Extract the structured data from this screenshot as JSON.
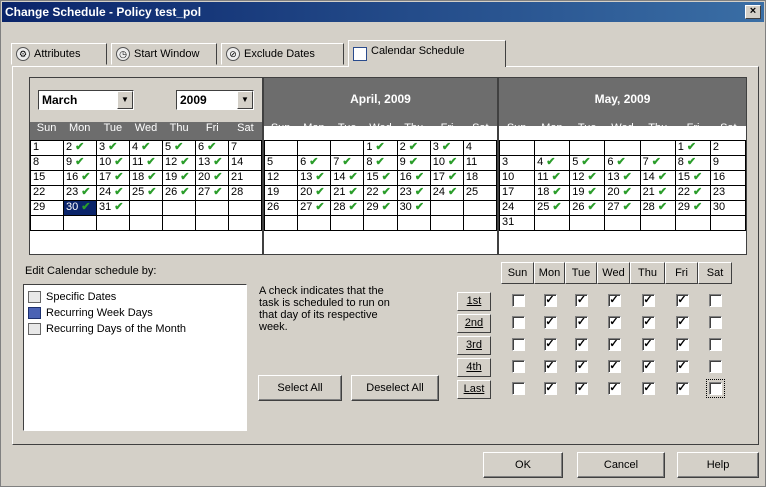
{
  "window": {
    "title": "Change Schedule - Policy test_pol",
    "close": "×"
  },
  "tabs": [
    {
      "label": "Attributes",
      "icon": "attributes-icon",
      "glyph": "⚙"
    },
    {
      "label": "Start Window",
      "icon": "start-window-icon",
      "glyph": "◷"
    },
    {
      "label": "Exclude Dates",
      "icon": "exclude-dates-icon",
      "glyph": "⊘"
    },
    {
      "label": "Calendar Schedule",
      "icon": "calendar-icon",
      "glyph": ""
    }
  ],
  "month_select": {
    "value": "March",
    "arrow": "▼"
  },
  "year_select": {
    "value": "2009",
    "arrow": "▼"
  },
  "calendars": [
    {
      "title": "",
      "dow": [
        "Sun",
        "Mon",
        "Tue",
        "Wed",
        "Thu",
        "Fri",
        "Sat"
      ],
      "weeks": [
        [
          {
            "d": "1",
            "c": false
          },
          {
            "d": "2",
            "c": true
          },
          {
            "d": "3",
            "c": true
          },
          {
            "d": "4",
            "c": true
          },
          {
            "d": "5",
            "c": true
          },
          {
            "d": "6",
            "c": true
          },
          {
            "d": "7",
            "c": false
          }
        ],
        [
          {
            "d": "8",
            "c": false
          },
          {
            "d": "9",
            "c": true
          },
          {
            "d": "10",
            "c": true
          },
          {
            "d": "11",
            "c": true
          },
          {
            "d": "12",
            "c": true
          },
          {
            "d": "13",
            "c": true
          },
          {
            "d": "14",
            "c": false
          }
        ],
        [
          {
            "d": "15",
            "c": false
          },
          {
            "d": "16",
            "c": true
          },
          {
            "d": "17",
            "c": true
          },
          {
            "d": "18",
            "c": true
          },
          {
            "d": "19",
            "c": true
          },
          {
            "d": "20",
            "c": true
          },
          {
            "d": "21",
            "c": false
          }
        ],
        [
          {
            "d": "22",
            "c": false
          },
          {
            "d": "23",
            "c": true
          },
          {
            "d": "24",
            "c": true
          },
          {
            "d": "25",
            "c": true
          },
          {
            "d": "26",
            "c": true
          },
          {
            "d": "27",
            "c": true
          },
          {
            "d": "28",
            "c": false
          }
        ],
        [
          {
            "d": "29",
            "c": false
          },
          {
            "d": "30",
            "c": true,
            "s": true
          },
          {
            "d": "31",
            "c": true
          },
          {
            "d": "",
            "c": false
          },
          {
            "d": "",
            "c": false
          },
          {
            "d": "",
            "c": false
          },
          {
            "d": "",
            "c": false
          }
        ],
        [
          {
            "d": "",
            "c": false
          },
          {
            "d": "",
            "c": false
          },
          {
            "d": "",
            "c": false
          },
          {
            "d": "",
            "c": false
          },
          {
            "d": "",
            "c": false
          },
          {
            "d": "",
            "c": false
          },
          {
            "d": "",
            "c": false
          }
        ]
      ]
    },
    {
      "title": "April, 2009",
      "dow": [
        "Sun",
        "Mon",
        "Tue",
        "Wed",
        "Thu",
        "Fri",
        "Sat"
      ],
      "weeks": [
        [
          {
            "d": "",
            "c": false
          },
          {
            "d": "",
            "c": false
          },
          {
            "d": "",
            "c": false
          },
          {
            "d": "1",
            "c": true
          },
          {
            "d": "2",
            "c": true
          },
          {
            "d": "3",
            "c": true
          },
          {
            "d": "4",
            "c": false
          }
        ],
        [
          {
            "d": "5",
            "c": false
          },
          {
            "d": "6",
            "c": true
          },
          {
            "d": "7",
            "c": true
          },
          {
            "d": "8",
            "c": true
          },
          {
            "d": "9",
            "c": true
          },
          {
            "d": "10",
            "c": true
          },
          {
            "d": "11",
            "c": false
          }
        ],
        [
          {
            "d": "12",
            "c": false
          },
          {
            "d": "13",
            "c": true
          },
          {
            "d": "14",
            "c": true
          },
          {
            "d": "15",
            "c": true
          },
          {
            "d": "16",
            "c": true
          },
          {
            "d": "17",
            "c": true
          },
          {
            "d": "18",
            "c": false
          }
        ],
        [
          {
            "d": "19",
            "c": false
          },
          {
            "d": "20",
            "c": true
          },
          {
            "d": "21",
            "c": true
          },
          {
            "d": "22",
            "c": true
          },
          {
            "d": "23",
            "c": true
          },
          {
            "d": "24",
            "c": true
          },
          {
            "d": "25",
            "c": false
          }
        ],
        [
          {
            "d": "26",
            "c": false
          },
          {
            "d": "27",
            "c": true
          },
          {
            "d": "28",
            "c": true
          },
          {
            "d": "29",
            "c": true
          },
          {
            "d": "30",
            "c": true
          },
          {
            "d": "",
            "c": false
          },
          {
            "d": "",
            "c": false
          }
        ],
        [
          {
            "d": "",
            "c": false
          },
          {
            "d": "",
            "c": false
          },
          {
            "d": "",
            "c": false
          },
          {
            "d": "",
            "c": false
          },
          {
            "d": "",
            "c": false
          },
          {
            "d": "",
            "c": false
          },
          {
            "d": "",
            "c": false
          }
        ]
      ]
    },
    {
      "title": "May, 2009",
      "dow": [
        "Sun",
        "Mon",
        "Tue",
        "Wed",
        "Thu",
        "Fri",
        "Sat"
      ],
      "weeks": [
        [
          {
            "d": "",
            "c": false
          },
          {
            "d": "",
            "c": false
          },
          {
            "d": "",
            "c": false
          },
          {
            "d": "",
            "c": false
          },
          {
            "d": "",
            "c": false
          },
          {
            "d": "1",
            "c": true
          },
          {
            "d": "2",
            "c": false
          }
        ],
        [
          {
            "d": "3",
            "c": false
          },
          {
            "d": "4",
            "c": true
          },
          {
            "d": "5",
            "c": true
          },
          {
            "d": "6",
            "c": true
          },
          {
            "d": "7",
            "c": true
          },
          {
            "d": "8",
            "c": true
          },
          {
            "d": "9",
            "c": false
          }
        ],
        [
          {
            "d": "10",
            "c": false
          },
          {
            "d": "11",
            "c": true
          },
          {
            "d": "12",
            "c": true
          },
          {
            "d": "13",
            "c": true
          },
          {
            "d": "14",
            "c": true
          },
          {
            "d": "15",
            "c": true
          },
          {
            "d": "16",
            "c": false
          }
        ],
        [
          {
            "d": "17",
            "c": false
          },
          {
            "d": "18",
            "c": true
          },
          {
            "d": "19",
            "c": true
          },
          {
            "d": "20",
            "c": true
          },
          {
            "d": "21",
            "c": true
          },
          {
            "d": "22",
            "c": true
          },
          {
            "d": "23",
            "c": false
          }
        ],
        [
          {
            "d": "24",
            "c": false
          },
          {
            "d": "25",
            "c": true
          },
          {
            "d": "26",
            "c": true
          },
          {
            "d": "27",
            "c": true
          },
          {
            "d": "28",
            "c": true
          },
          {
            "d": "29",
            "c": true
          },
          {
            "d": "30",
            "c": false
          }
        ],
        [
          {
            "d": "31",
            "c": false
          },
          {
            "d": "",
            "c": false
          },
          {
            "d": "",
            "c": false
          },
          {
            "d": "",
            "c": false
          },
          {
            "d": "",
            "c": false
          },
          {
            "d": "",
            "c": false
          },
          {
            "d": "",
            "c": false
          }
        ]
      ]
    }
  ],
  "check_glyph": "✔",
  "edit_label": "Edit Calendar schedule by:",
  "schedule_options": [
    {
      "label": "Specific Dates",
      "icon": "specific-dates-icon"
    },
    {
      "label": "Recurring Week Days",
      "icon": "recurring-week-days-icon"
    },
    {
      "label": "Recurring Days of the Month",
      "icon": "recurring-days-month-icon"
    }
  ],
  "help_text": [
    "A check indicates that the",
    "task is scheduled to run on",
    "that day of its respective",
    "week."
  ],
  "buttons": {
    "select_all": "Select All",
    "deselect_all": "Deselect All",
    "ok": "OK",
    "cancel": "Cancel",
    "help": "Help"
  },
  "week_buttons": [
    "1st",
    "2nd",
    "3rd",
    "4th",
    "Last"
  ],
  "weekday_headers": [
    "Sun",
    "Mon",
    "Tue",
    "Wed",
    "Thu",
    "Fri",
    "Sat"
  ],
  "weekday_matrix": [
    [
      false,
      true,
      true,
      true,
      true,
      true,
      false
    ],
    [
      false,
      true,
      true,
      true,
      true,
      true,
      false
    ],
    [
      false,
      true,
      true,
      true,
      true,
      true,
      false
    ],
    [
      false,
      true,
      true,
      true,
      true,
      true,
      false
    ],
    [
      false,
      true,
      true,
      true,
      true,
      true,
      false
    ]
  ],
  "colors": {
    "check": "#2a9d2a",
    "title_bar": "#0a246a",
    "header": "#6d6d6d"
  }
}
